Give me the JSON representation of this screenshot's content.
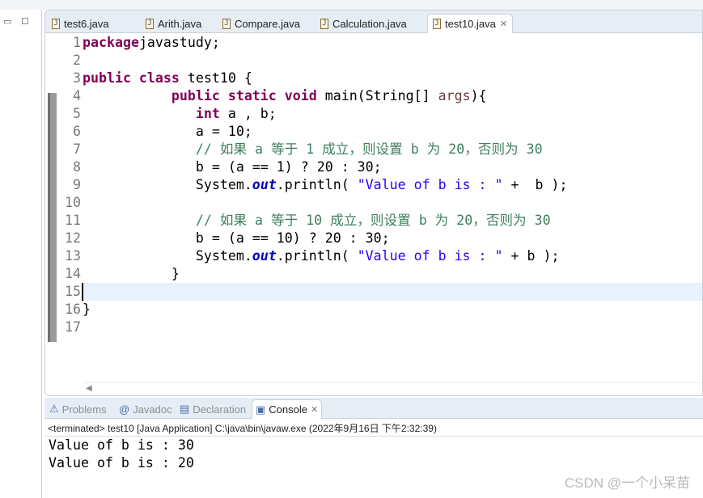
{
  "editor": {
    "tabs": [
      {
        "label": "test6.java"
      },
      {
        "label": "Arith.java"
      },
      {
        "label": "Compare.java"
      },
      {
        "label": "Calculation.java"
      },
      {
        "label": "test10.java",
        "active": true
      }
    ],
    "lines": [
      [
        [
          "kw",
          "package"
        ],
        [
          "",
          "javastudy;"
        ]
      ],
      [],
      [
        [
          "kw",
          "public class"
        ],
        [
          "",
          " test10 {"
        ]
      ],
      [
        [
          "",
          "           "
        ],
        [
          "kw",
          "public static void"
        ],
        [
          "",
          " main(String[] "
        ],
        [
          "pm",
          "args"
        ],
        [
          "",
          "){"
        ]
      ],
      [
        [
          "",
          "              "
        ],
        [
          "kw",
          "int"
        ],
        [
          "",
          " a , b;"
        ]
      ],
      [
        [
          "",
          "              a = 10;"
        ]
      ],
      [
        [
          "",
          "              "
        ],
        [
          "cm",
          "// 如果 a 等于 1 成立，则设置 b 为 20，否则为 30"
        ]
      ],
      [
        [
          "",
          "              b = (a == 1) ? 20 : 30;"
        ]
      ],
      [
        [
          "",
          "              System."
        ],
        [
          "fd",
          "out"
        ],
        [
          "",
          ".println( "
        ],
        [
          "st",
          "\"Value of b is : \""
        ],
        [
          "",
          " +  b );"
        ]
      ],
      [],
      [
        [
          "",
          "              "
        ],
        [
          "cm",
          "// 如果 a 等于 10 成立，则设置 b 为 20，否则为 30"
        ]
      ],
      [
        [
          "",
          "              b = (a == 10) ? 20 : 30;"
        ]
      ],
      [
        [
          "",
          "              System."
        ],
        [
          "fd",
          "out"
        ],
        [
          "",
          ".println( "
        ],
        [
          "st",
          "\"Value of b is : \""
        ],
        [
          "",
          " + b );"
        ]
      ],
      [
        [
          "",
          "           }"
        ]
      ],
      [],
      [
        [
          "",
          "}"
        ]
      ],
      []
    ],
    "current_line": 15
  },
  "console": {
    "tabs": [
      {
        "label": "Problems"
      },
      {
        "label": "Javadoc"
      },
      {
        "label": "Declaration"
      },
      {
        "label": "Console",
        "active": true
      }
    ],
    "header": "<terminated> test10 [Java Application] C:\\java\\bin\\javaw.exe (2022年9月16日 下午2:32:39)",
    "output": [
      "Value of b is : 30",
      "Value of b is : 20"
    ]
  },
  "watermark": "CSDN @一个小呆苗"
}
